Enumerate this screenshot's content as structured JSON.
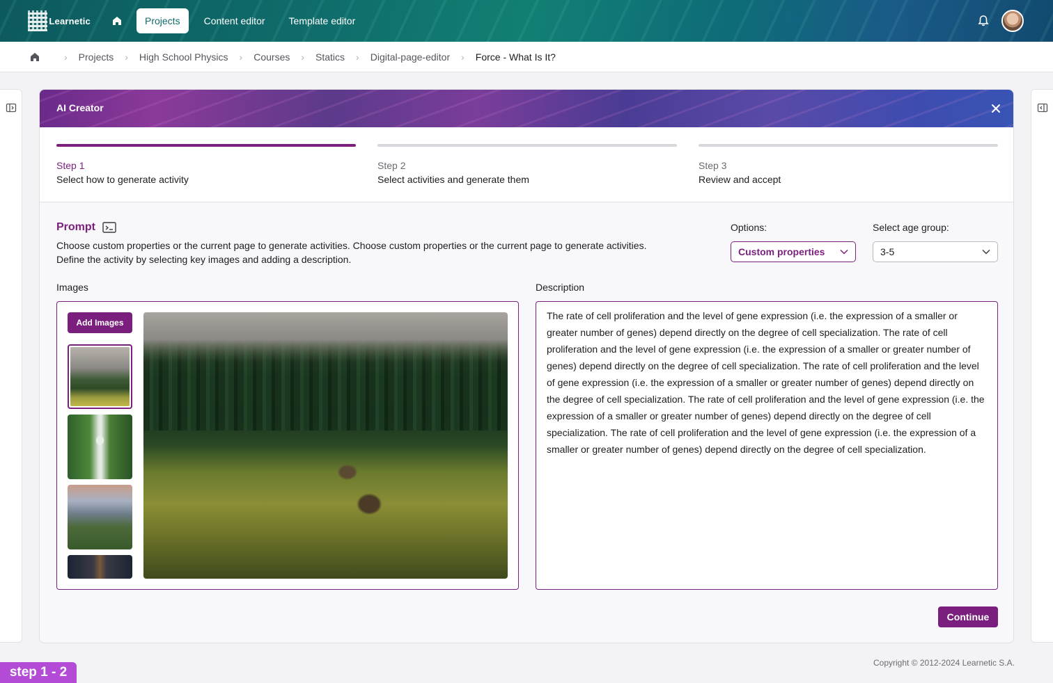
{
  "app": {
    "logo_text": "Learnetic"
  },
  "nav": {
    "items": [
      {
        "label": "Projects",
        "active": true
      },
      {
        "label": "Content editor",
        "active": false
      },
      {
        "label": "Template editor",
        "active": false
      }
    ]
  },
  "breadcrumb": {
    "items": [
      "Projects",
      "High School Physics",
      "Courses",
      "Statics",
      "Digital-page-editor"
    ],
    "current": "Force - What Is It?"
  },
  "modal": {
    "title": "AI Creator",
    "steps": [
      {
        "number": "Step 1",
        "description": "Select how to generate activity",
        "active": true
      },
      {
        "number": "Step 2",
        "description": "Select activities and generate them",
        "active": false
      },
      {
        "number": "Step 3",
        "description": "Review and accept",
        "active": false
      }
    ],
    "prompt": {
      "title": "Prompt",
      "line1": "Choose custom properties or the current page to generate activities. Choose custom properties or the current page to generate activities.",
      "line2": "Define the activity by selecting key images and adding a description."
    },
    "options": {
      "label": "Options:",
      "selected": "Custom properties"
    },
    "age_group": {
      "label": "Select age group:",
      "selected": "3-5"
    },
    "images": {
      "label": "Images",
      "add_button": "Add Images"
    },
    "description": {
      "label": "Description",
      "text": "The rate of cell proliferation and the level of gene expression (i.e. the expression of a smaller or greater number of genes) depend directly on the degree of cell specialization. The rate of cell proliferation and the level of gene expression (i.e. the expression of a smaller or greater number of genes) depend directly on the degree of cell specialization. The rate of cell proliferation and the level of gene expression (i.e. the expression of a smaller or greater number of genes) depend directly on the degree of cell specialization. The rate of cell proliferation and the level of gene expression (i.e. the expression of a smaller or greater number of genes) depend directly on the degree of cell specialization. The rate of cell proliferation and the level of gene expression (i.e. the expression of a smaller or greater number of genes) depend directly on the degree of cell specialization."
    },
    "continue_label": "Continue"
  },
  "footer": {
    "copyright": "Copyright © 2012-2024 Learnetic S.A."
  },
  "annotation_tag": "step 1 - 2",
  "colors": {
    "accent": "#7a1f7e",
    "nav_active_text": "#0f6d6a"
  }
}
